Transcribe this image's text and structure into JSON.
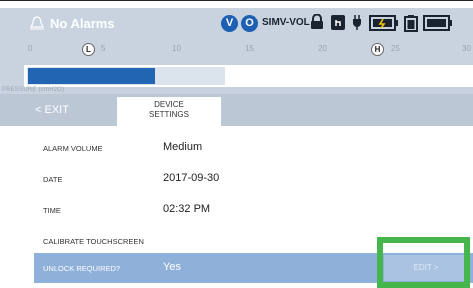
{
  "header": {
    "alarm_text": "No Alarms",
    "badges": [
      "V",
      "O"
    ],
    "mode": "SIMV-VOL"
  },
  "scale": {
    "ticks": [
      "0",
      "5",
      "10",
      "15",
      "20",
      "25",
      "30"
    ],
    "marker_low": "L",
    "marker_high": "H",
    "pressure_label": "PRESSURE (cmH2O)"
  },
  "tabs": {
    "exit": "< EXIT",
    "device_line1": "DEVICE",
    "device_line2": "SETTINGS"
  },
  "settings": [
    {
      "label": "ALARM VOLUME",
      "value": "Medium"
    },
    {
      "label": "DATE",
      "value": "2017-09-30"
    },
    {
      "label": "TIME",
      "value": "02:32 PM"
    },
    {
      "label": "CALIBRATE TOUCHSCREEN",
      "value": ""
    },
    {
      "label": "UNLOCK REQUIRED?",
      "value": "Yes",
      "action": "EDIT >"
    }
  ],
  "colors": {
    "accent": "#1c5fb3",
    "header_bg": "#c9d3df",
    "selected_row": "#8fb0d8",
    "highlight": "#44b64b"
  },
  "icons": [
    "bell-icon",
    "lock-icon",
    "touch-icon",
    "plug-icon",
    "battery-charging-icon",
    "battery-icon"
  ]
}
